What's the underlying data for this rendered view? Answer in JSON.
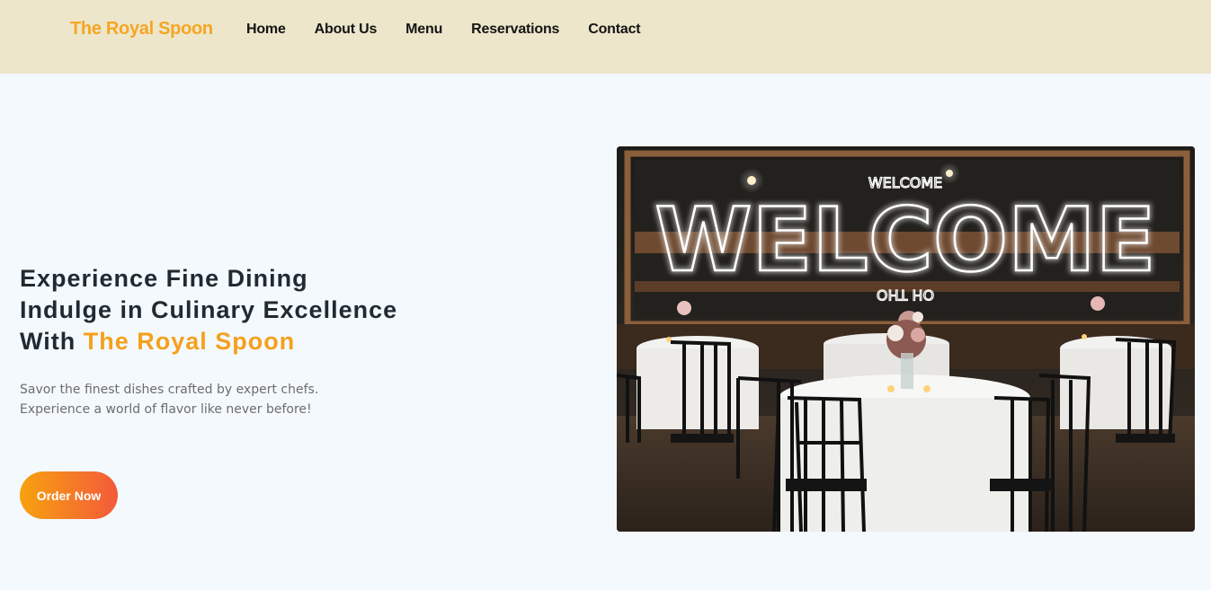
{
  "navbar": {
    "brand": "The Royal Spoon",
    "links": [
      "Home",
      "About Us",
      "Menu",
      "Reservations",
      "Contact"
    ]
  },
  "hero": {
    "title_line1": "Experience Fine Dining",
    "title_line2": "Indulge in Culinary Excellence",
    "title_line3_prefix": "With ",
    "title_line3_accent": "The Royal Spoon",
    "description_line1": "Savor the finest dishes crafted by expert chefs.",
    "description_line2": "Experience a world of flavor like never before!",
    "cta_label": "Order Now",
    "image": {
      "neon_sign": "WELCOME",
      "neon_small_top": "WELCOME",
      "neon_small_bottom": "OH THO"
    }
  },
  "colors": {
    "navbar_bg": "#ede6cb",
    "page_bg": "#f4f9fd",
    "brand_accent": "#f5a623",
    "heading": "#1f2a33",
    "button_gradient_start": "#f7a20f",
    "button_gradient_end": "#f35a3a"
  }
}
